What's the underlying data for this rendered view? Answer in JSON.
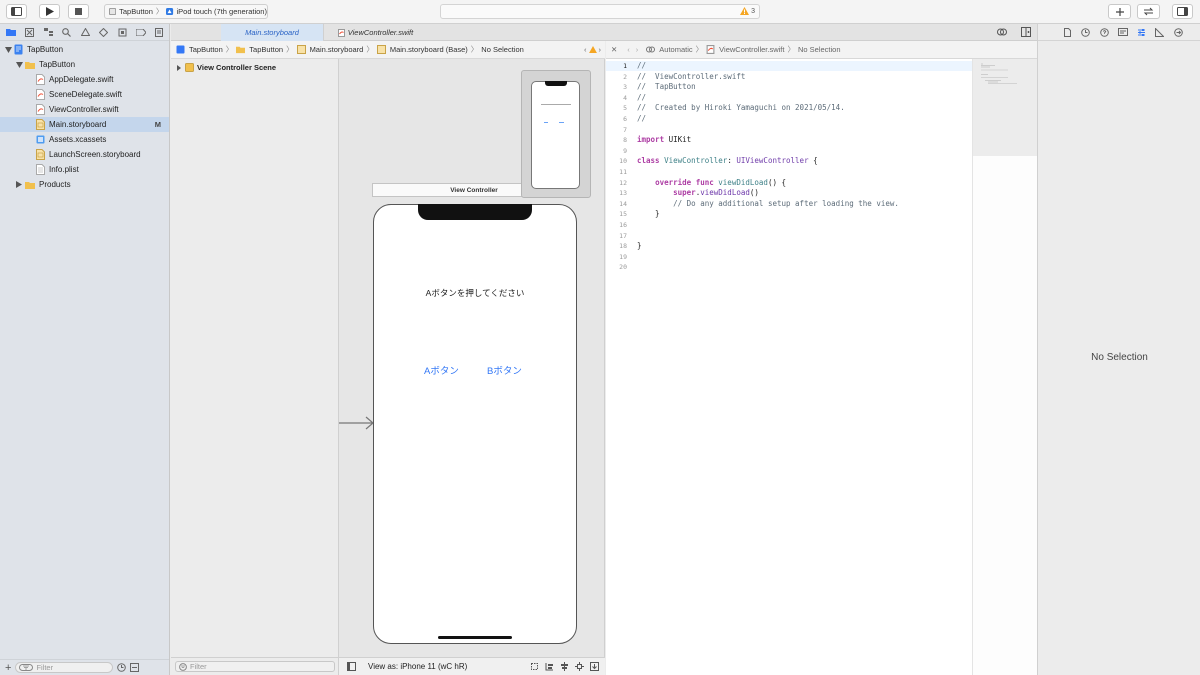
{
  "toolbar": {
    "scheme_project": "TapButton",
    "scheme_device": "iPod touch (7th generation)",
    "warning_count": "3"
  },
  "navigator": {
    "items": [
      {
        "label": "TapButton",
        "kind": "project",
        "depth": 0,
        "expanded": true
      },
      {
        "label": "TapButton",
        "kind": "folder",
        "depth": 1,
        "expanded": true
      },
      {
        "label": "AppDelegate.swift",
        "kind": "swift",
        "depth": 2
      },
      {
        "label": "SceneDelegate.swift",
        "kind": "swift",
        "depth": 2
      },
      {
        "label": "ViewController.swift",
        "kind": "swift",
        "depth": 2
      },
      {
        "label": "Main.storyboard",
        "kind": "storyboard",
        "depth": 2,
        "selected": true,
        "badge": "M"
      },
      {
        "label": "Assets.xcassets",
        "kind": "assets",
        "depth": 2
      },
      {
        "label": "LaunchScreen.storyboard",
        "kind": "storyboard",
        "depth": 2
      },
      {
        "label": "Info.plist",
        "kind": "plist",
        "depth": 2
      },
      {
        "label": "Products",
        "kind": "folder",
        "depth": 1,
        "expanded": false
      }
    ],
    "filter_placeholder": "Filter"
  },
  "tabs": [
    {
      "label": "Main.storyboard",
      "active": true
    },
    {
      "label": "ViewController.swift",
      "active": false
    }
  ],
  "jumpbar_left": {
    "crumbs": [
      "TapButton",
      "TapButton",
      "Main.storyboard",
      "Main.storyboard (Base)",
      "No Selection"
    ]
  },
  "jumpbar_right": {
    "crumbs": [
      "Automatic",
      "ViewController.swift",
      "No Selection"
    ]
  },
  "outline": {
    "scene_label": "View Controller Scene",
    "filter_placeholder": "Filter"
  },
  "canvas": {
    "scene_title": "View Controller",
    "label_text": "Aボタンを押してください",
    "button_a": "Aボタン",
    "button_b": "Bボタン",
    "view_as": "View as: iPhone 11 (wC hR)"
  },
  "code": {
    "lines": [
      {
        "n": "1",
        "t": "//"
      },
      {
        "n": "2",
        "t": "//  ViewController.swift"
      },
      {
        "n": "3",
        "t": "//  TapButton"
      },
      {
        "n": "4",
        "t": "//"
      },
      {
        "n": "5",
        "t": "//  Created by Hiroki Yamaguchi on 2021/05/14."
      },
      {
        "n": "6",
        "t": "//"
      },
      {
        "n": "7",
        "t": ""
      },
      {
        "n": "8",
        "t": "import UIKit"
      },
      {
        "n": "9",
        "t": ""
      },
      {
        "n": "10",
        "t": "class ViewController: UIViewController {"
      },
      {
        "n": "11",
        "t": ""
      },
      {
        "n": "12",
        "t": "    override func viewDidLoad() {"
      },
      {
        "n": "13",
        "t": "        super.viewDidLoad()"
      },
      {
        "n": "14",
        "t": "        // Do any additional setup after loading the view."
      },
      {
        "n": "15",
        "t": "    }"
      },
      {
        "n": "16",
        "t": ""
      },
      {
        "n": "17",
        "t": ""
      },
      {
        "n": "18",
        "t": "}"
      },
      {
        "n": "19",
        "t": ""
      },
      {
        "n": "20",
        "t": ""
      }
    ]
  },
  "inspector": {
    "empty_text": "No Selection"
  },
  "colors": {
    "accent": "#3478f6",
    "selection": "#c4d6ec",
    "warning": "#f5a623"
  }
}
